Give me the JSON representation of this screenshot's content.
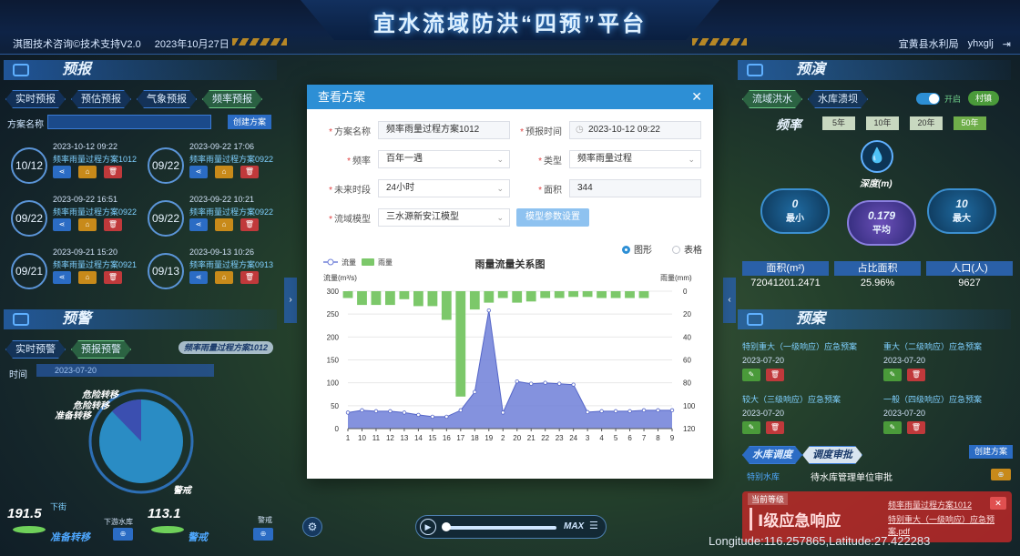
{
  "header": {
    "title": "宜水流域防洪“四预”平台",
    "tech_support": "淇图技术咨询©技术支持V2.0",
    "date": "2023年10月27日",
    "org": "宜黄县水利局",
    "user": "yhxglj",
    "logout_icon": "logout-icon"
  },
  "left": {
    "forecast": {
      "title": "预报",
      "tabs": [
        "实时预报",
        "预估预报",
        "气象预报",
        "频率预报"
      ],
      "name_label": "方案名称",
      "create_btn": "创建方案",
      "plans": [
        {
          "day": "10/12",
          "time": "2023-10-12 09:22",
          "name": "频率雨量过程方案1012"
        },
        {
          "day": "09/22",
          "time": "2023-09-22 17:06",
          "name": "频率雨量过程方案0922"
        },
        {
          "day": "09/22",
          "time": "2023-09-22 16:51",
          "name": "频率雨量过程方案0922"
        },
        {
          "day": "09/22",
          "time": "2023-09-22 10:21",
          "name": "频率雨量过程方案0922"
        },
        {
          "day": "09/21",
          "time": "2023-09-21 15:20",
          "name": "频率雨量过程方案0921"
        },
        {
          "day": "09/13",
          "time": "2023-09-13 10:26",
          "name": "频率雨量过程方案0913"
        }
      ]
    },
    "warning": {
      "title": "预警",
      "tabs": [
        "实时预警",
        "预报预警"
      ],
      "plan_badge": "频率雨量过程方案1012",
      "time_label": "时间",
      "time_value": "2023-07-20",
      "pie_labels": [
        "危险转移",
        "危险转移",
        "准备转移"
      ],
      "legend_bottom": "警戒",
      "value_left": "191.5",
      "value_left_label": "下街",
      "value_left_status": "准备转移",
      "value_mid": "113.1",
      "value_mid_status": "警戒",
      "reservoir_label": "下游水库",
      "level_label": "警戒"
    }
  },
  "right": {
    "rehearsal": {
      "title": "预演",
      "tabs": [
        "流域洪水",
        "水库溃坝"
      ],
      "toggle_label": "开启",
      "toggle_chip": "村镇",
      "freq_label": "频率",
      "freq_options": [
        "5年",
        "10年",
        "20年",
        "50年"
      ],
      "depth_label": "深度(m)",
      "stats": [
        {
          "value": "0",
          "label": "最小"
        },
        {
          "value": "0.179",
          "label": "平均"
        },
        {
          "value": "10",
          "label": "最大"
        }
      ],
      "table_headers": [
        "面积(m²)",
        "占比面积",
        "人口(人)"
      ],
      "table_values": [
        "72041201.2471",
        "25.96%",
        "9627"
      ]
    },
    "plan": {
      "title": "预案",
      "items": [
        {
          "name": "特别重大（一级响应）应急预案",
          "date": "2023-07-20"
        },
        {
          "name": "重大（二级响应）应急预案",
          "date": "2023-07-20"
        },
        {
          "name": "较大（三级响应）应急预案",
          "date": "2023-07-20"
        },
        {
          "name": "一般（四级响应）应急预案",
          "date": "2023-07-20"
        }
      ],
      "tabs": [
        "水库调度",
        "调度审批"
      ],
      "create_btn": "创建方案",
      "approval_item": "待水库管理单位审批",
      "approval_sub": "特别水库"
    },
    "alert": {
      "level_label": "当前等级",
      "level_text": "Ⅰ级应急响应",
      "plan_name": "频率雨量过程方案1012",
      "plan_sub": "特别重大（一级响应）应急预案.pdf"
    }
  },
  "modal": {
    "title": "查看方案",
    "fields": {
      "plan_name_label": "方案名称",
      "plan_name": "频率雨量过程方案1012",
      "forecast_time_label": "预报时间",
      "forecast_time": "2023-10-12 09:22",
      "freq_label": "频率",
      "freq": "百年一遇",
      "type_label": "类型",
      "type": "频率雨量过程",
      "period_label": "未来时段",
      "period": "24小时",
      "area_label": "面积",
      "area": "344",
      "model_label": "流域模型",
      "model": "三水源新安江模型",
      "model_btn": "模型参数设置"
    },
    "view_options": [
      "图形",
      "表格"
    ],
    "view_selected": "图形"
  },
  "chart_data": {
    "type": "line",
    "title": "雨量流量关系图",
    "xlabel": "",
    "ylabel": "流量(m³/s)",
    "y2label": "雨量(mm)",
    "legend": [
      "流量",
      "雨量"
    ],
    "categories": [
      "1",
      "10",
      "11",
      "12",
      "13",
      "14",
      "15",
      "16",
      "17",
      "18",
      "19",
      "2",
      "20",
      "21",
      "22",
      "23",
      "24",
      "3",
      "4",
      "5",
      "6",
      "7",
      "8",
      "9"
    ],
    "series": [
      {
        "name": "流量",
        "type": "area",
        "axis": "left",
        "values": [
          35,
          40,
          38,
          38,
          35,
          30,
          26,
          26,
          40,
          80,
          258,
          35,
          103,
          98,
          100,
          98,
          96,
          36,
          38,
          38,
          38,
          40,
          40,
          40
        ]
      },
      {
        "name": "雨量",
        "type": "bar",
        "axis": "right",
        "inverted": true,
        "values": [
          6,
          12,
          12,
          12,
          7,
          13,
          13,
          25,
          92,
          16,
          10,
          6,
          10,
          9,
          6,
          6,
          5,
          5,
          6,
          6,
          6,
          6
        ]
      }
    ],
    "ylim": [
      0,
      300
    ],
    "y2lim": [
      0,
      120
    ],
    "yticks": [
      0,
      50,
      100,
      150,
      200,
      250,
      300
    ],
    "y2ticks": [
      0,
      20,
      40,
      60,
      80,
      100,
      120
    ],
    "colors": {
      "flow": "#6f7fd8",
      "rain": "#7cc86a"
    }
  },
  "footer": {
    "coords": "Longitude:116.257865,Latitude:27.422283",
    "max_label": "MAX"
  }
}
